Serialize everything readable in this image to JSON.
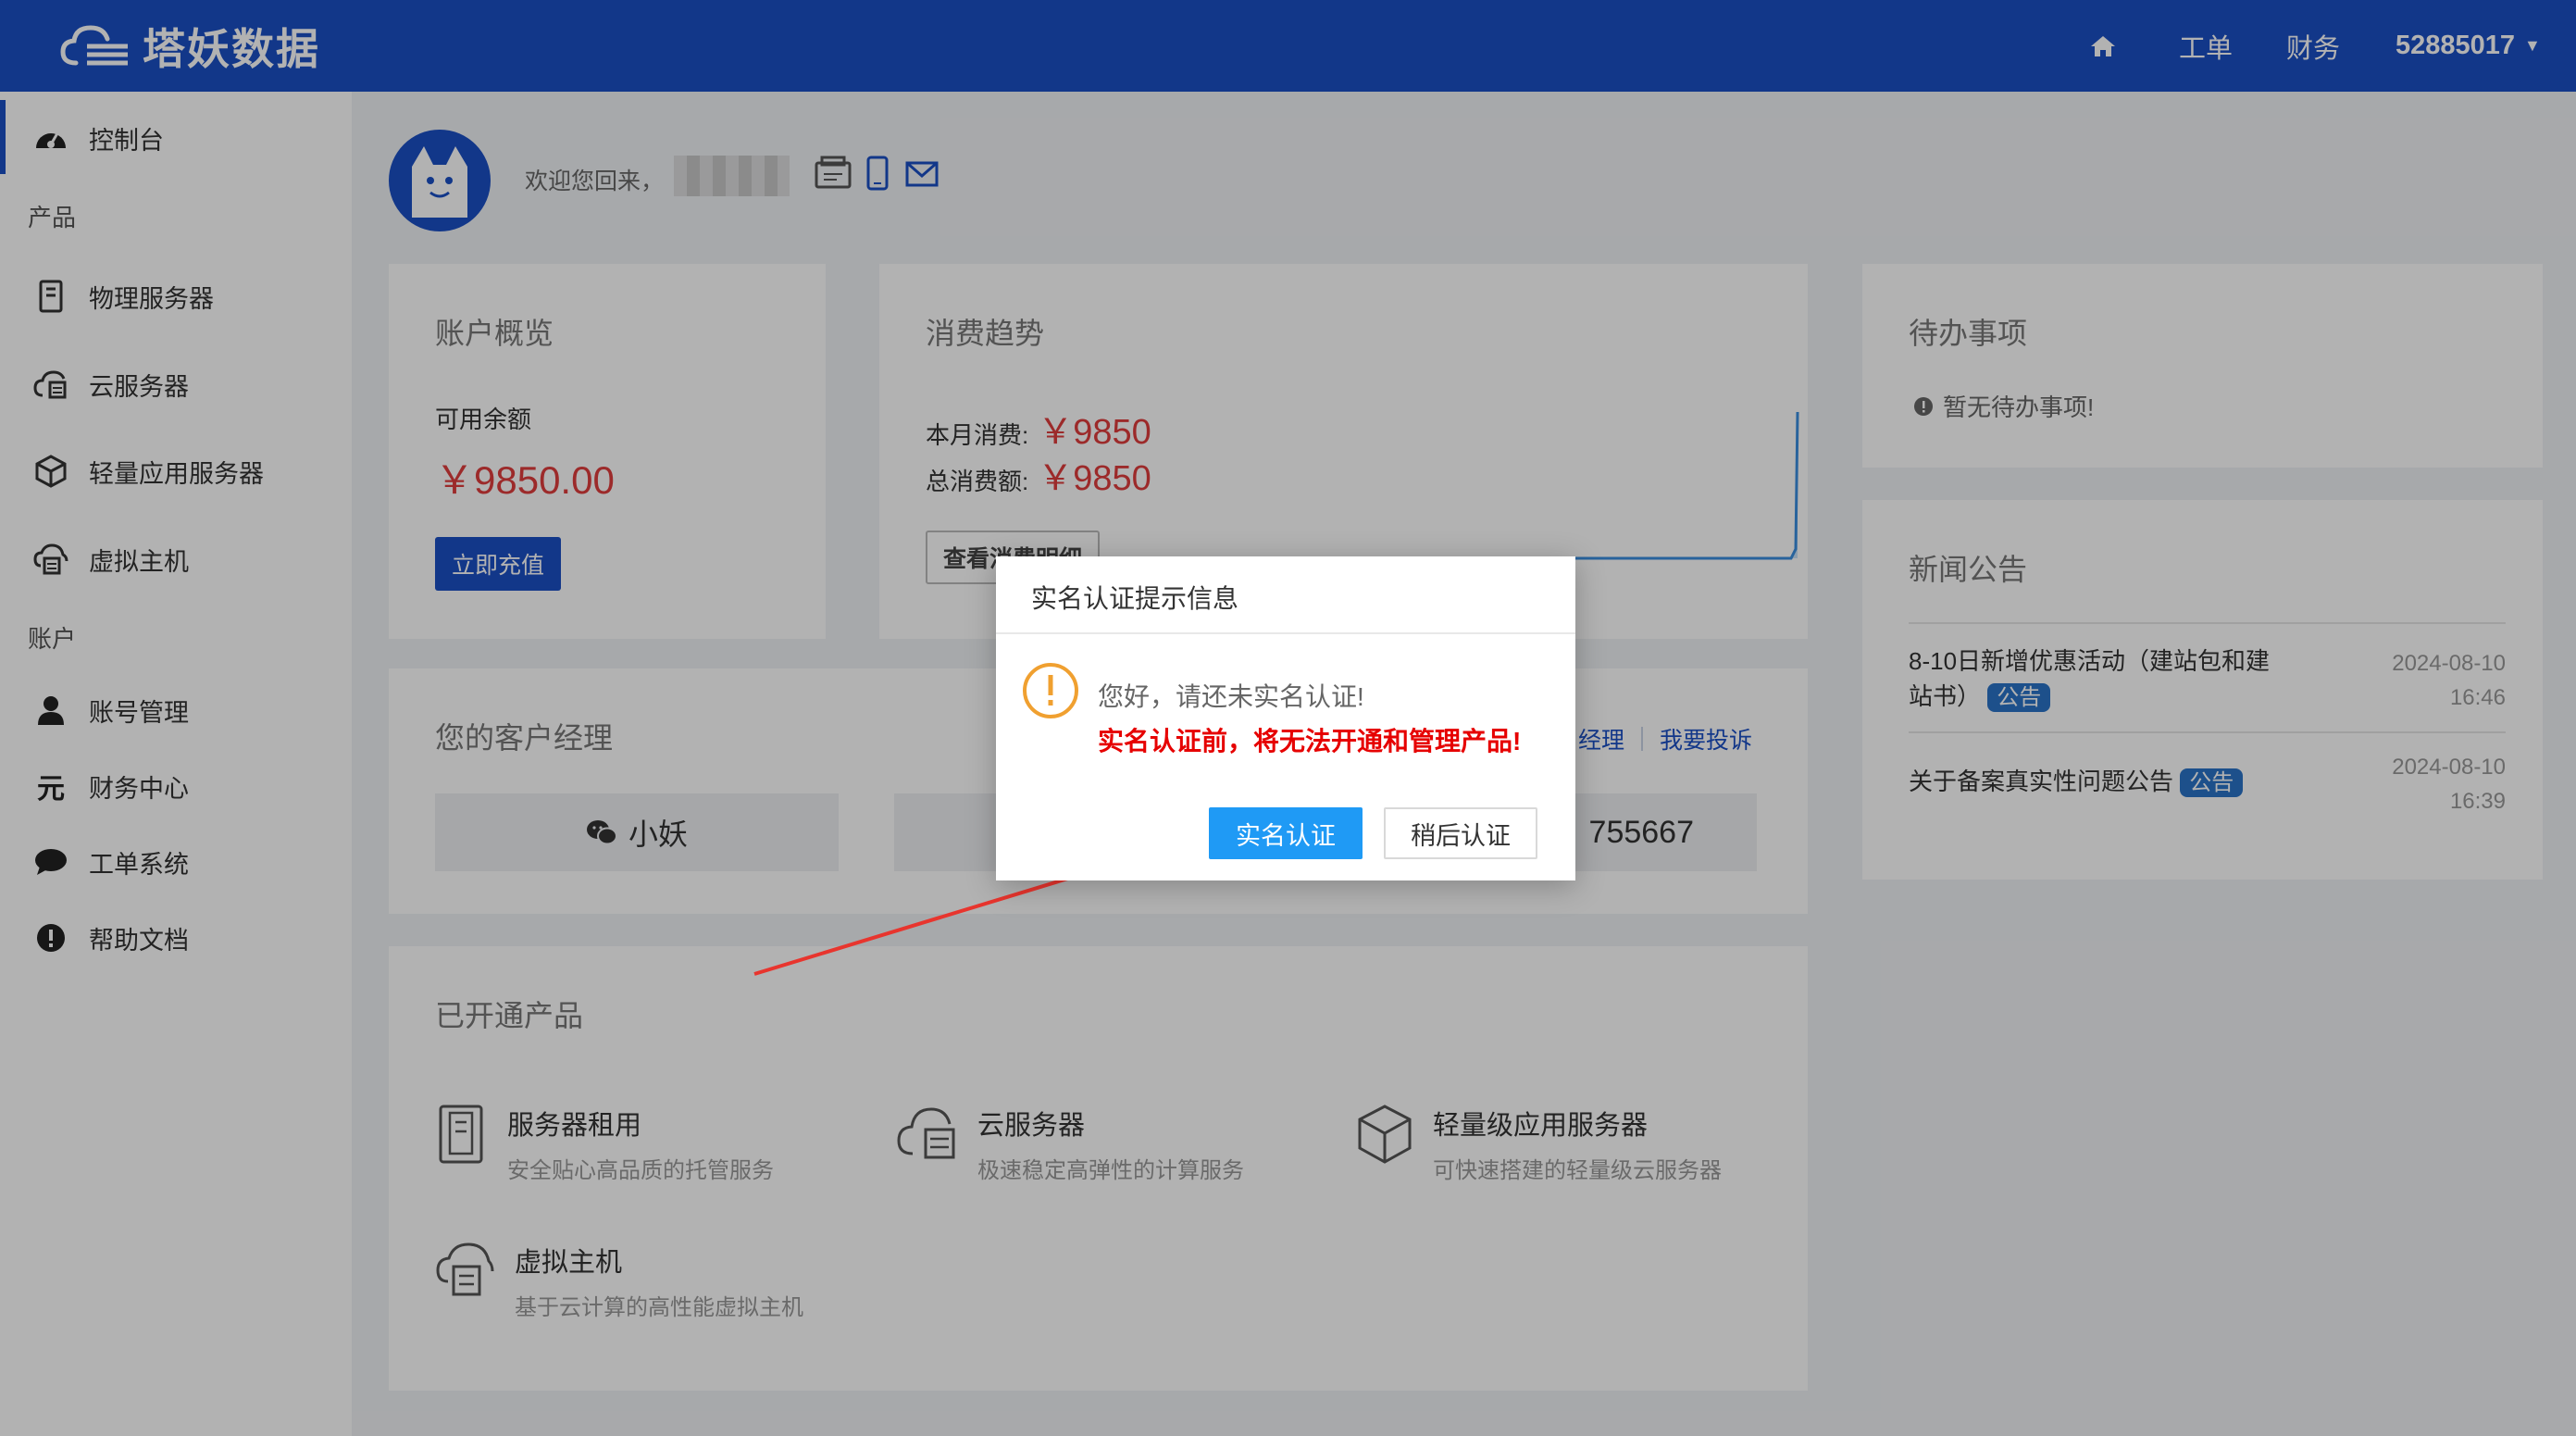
{
  "header": {
    "brand": "塔妖数据",
    "nav": {
      "home_icon": "home-icon",
      "ticket": "工单",
      "finance": "财务",
      "account_id": "52885017"
    }
  },
  "sidebar": {
    "dashboard": "控制台",
    "group_products": "产品",
    "items_products": [
      {
        "label": "物理服务器",
        "icon": "server-icon"
      },
      {
        "label": "云服务器",
        "icon": "cloud-server-icon"
      },
      {
        "label": "轻量应用服务器",
        "icon": "cube-icon"
      },
      {
        "label": "虚拟主机",
        "icon": "virtual-host-icon"
      }
    ],
    "group_account": "账户",
    "items_account": [
      {
        "label": "账号管理",
        "icon": "user-icon"
      },
      {
        "label": "财务中心",
        "icon": "yuan-icon"
      },
      {
        "label": "工单系统",
        "icon": "chat-icon"
      },
      {
        "label": "帮助文档",
        "icon": "info-icon"
      }
    ]
  },
  "welcome": {
    "text": "欢迎您回来，"
  },
  "account_overview": {
    "title": "账户概览",
    "balance_label": "可用余额",
    "balance": "￥9850.00",
    "recharge_button": "立即充值"
  },
  "consumption": {
    "title": "消费趋势",
    "month_label": "本月消费:",
    "month_value": "￥9850",
    "total_label": "总消费额:",
    "total_value": "￥9850",
    "detail_button": "查看消费明细"
  },
  "todo": {
    "title": "待办事项",
    "empty": "暂无待办事项!"
  },
  "news": {
    "title": "新闻公告",
    "items": [
      {
        "text": "8-10日新增优惠活动（建站包和建站书）",
        "badge": "公告",
        "date": "2024-08-10",
        "time": "16:46"
      },
      {
        "text": "关于备案真实性问题公告",
        "badge": "公告",
        "date": "2024-08-10",
        "time": "16:39"
      }
    ]
  },
  "manager": {
    "title": "您的客户经理",
    "name": "小妖",
    "phone_suffix": "755667",
    "link_change": "经理",
    "link_complain": "我要投诉"
  },
  "products": {
    "title": "已开通产品",
    "items": [
      {
        "name": "服务器租用",
        "desc": "安全贴心高品质的托管服务",
        "icon": "server-icon"
      },
      {
        "name": "云服务器",
        "desc": "极速稳定高弹性的计算服务",
        "icon": "cloud-server-icon"
      },
      {
        "name": "轻量级应用服务器",
        "desc": "可快速搭建的轻量级云服务器",
        "icon": "cube-icon"
      },
      {
        "name": "虚拟主机",
        "desc": "基于云计算的高性能虚拟主机",
        "icon": "virtual-host-icon"
      }
    ]
  },
  "modal": {
    "title": "实名认证提示信息",
    "message": "您好，请还未实名认证!",
    "warning": "实名认证前，将无法开通和管理产品!",
    "confirm_button": "实名认证",
    "later_button": "稍后认证"
  },
  "colors": {
    "brand": "#1b4fc5",
    "accent_red": "#e03d3d",
    "warning_red": "#e60000",
    "modal_primary": "#1f9af5",
    "arrow": "#e8352e"
  }
}
